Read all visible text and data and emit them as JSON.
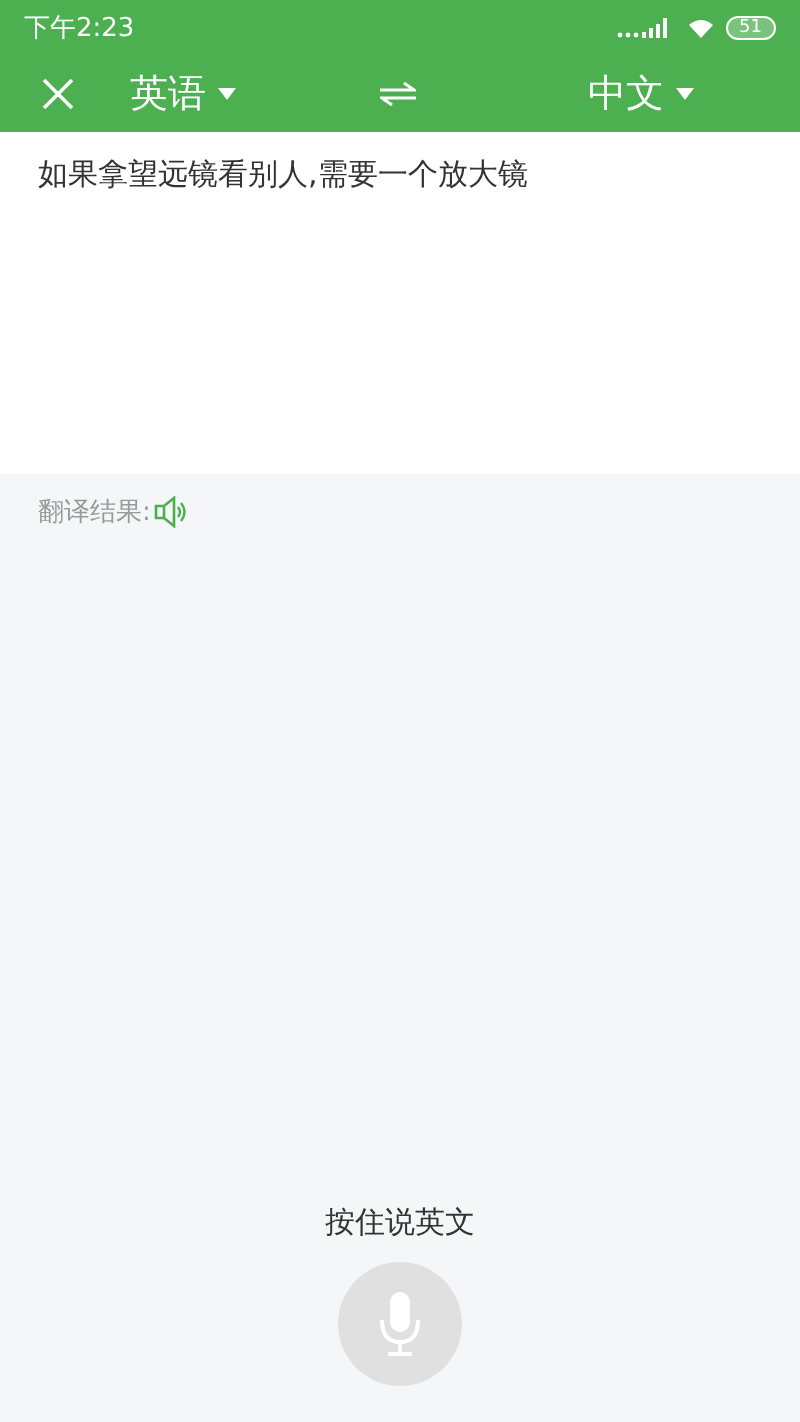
{
  "status_bar": {
    "time": "下午2:23",
    "battery": "51"
  },
  "toolbar": {
    "source_language": "英语",
    "target_language": "中文"
  },
  "input": {
    "value": "如果拿望远镜看别人,需要一个放大镜"
  },
  "result": {
    "label": "翻译结果:"
  },
  "voice": {
    "prompt": "按住说英文"
  }
}
